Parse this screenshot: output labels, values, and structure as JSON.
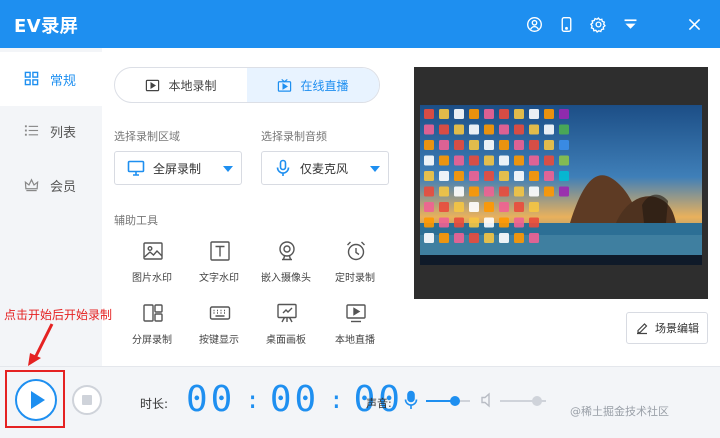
{
  "app": {
    "title": "EV录屏"
  },
  "colors": {
    "accent": "#1e8ff0",
    "annotation": "#e52222",
    "sidebar_bg": "#f3f5f8"
  },
  "titlebar": {
    "icons": [
      "user-icon",
      "phone-icon",
      "settings-icon",
      "menu-icon",
      "close-icon"
    ]
  },
  "sidebar": {
    "items": [
      {
        "label": "常规",
        "icon": "grid-icon",
        "active": true
      },
      {
        "label": "列表",
        "icon": "list-icon",
        "active": false
      },
      {
        "label": "会员",
        "icon": "crown-icon",
        "active": false
      }
    ]
  },
  "tabs": [
    {
      "label": "本地录制",
      "icon": "video-icon",
      "active": false
    },
    {
      "label": "在线直播",
      "icon": "live-tv-icon",
      "active": true
    }
  ],
  "record_area": {
    "label": "选择录制区域",
    "value": "全屏录制",
    "icon": "monitor-icon"
  },
  "audio": {
    "label": "选择录制音频",
    "value": "仅麦克风",
    "icon": "microphone-icon"
  },
  "tools": {
    "title": "辅助工具",
    "items": [
      {
        "label": "图片水印",
        "icon": "image-icon"
      },
      {
        "label": "文字水印",
        "icon": "text-icon"
      },
      {
        "label": "嵌入摄像头",
        "icon": "camera-icon"
      },
      {
        "label": "定时录制",
        "icon": "alarm-clock-icon"
      },
      {
        "label": "分屏录制",
        "icon": "split-screen-icon"
      },
      {
        "label": "按键显示",
        "icon": "keyboard-icon"
      },
      {
        "label": "桌面画板",
        "icon": "drawing-board-icon"
      },
      {
        "label": "本地直播",
        "icon": "local-live-icon"
      }
    ]
  },
  "preview": {
    "scene_button": "场景编辑"
  },
  "annotation": {
    "text": "点击开始后开始录制"
  },
  "bottom": {
    "duration_label": "时长:",
    "timer": {
      "hours": "00",
      "minutes": "00",
      "seconds": "00"
    },
    "volume_label": "声音:",
    "mic_volume": 0.65,
    "speaker_volume": 0.8
  },
  "watermark": "@稀土掘金技术社区"
}
